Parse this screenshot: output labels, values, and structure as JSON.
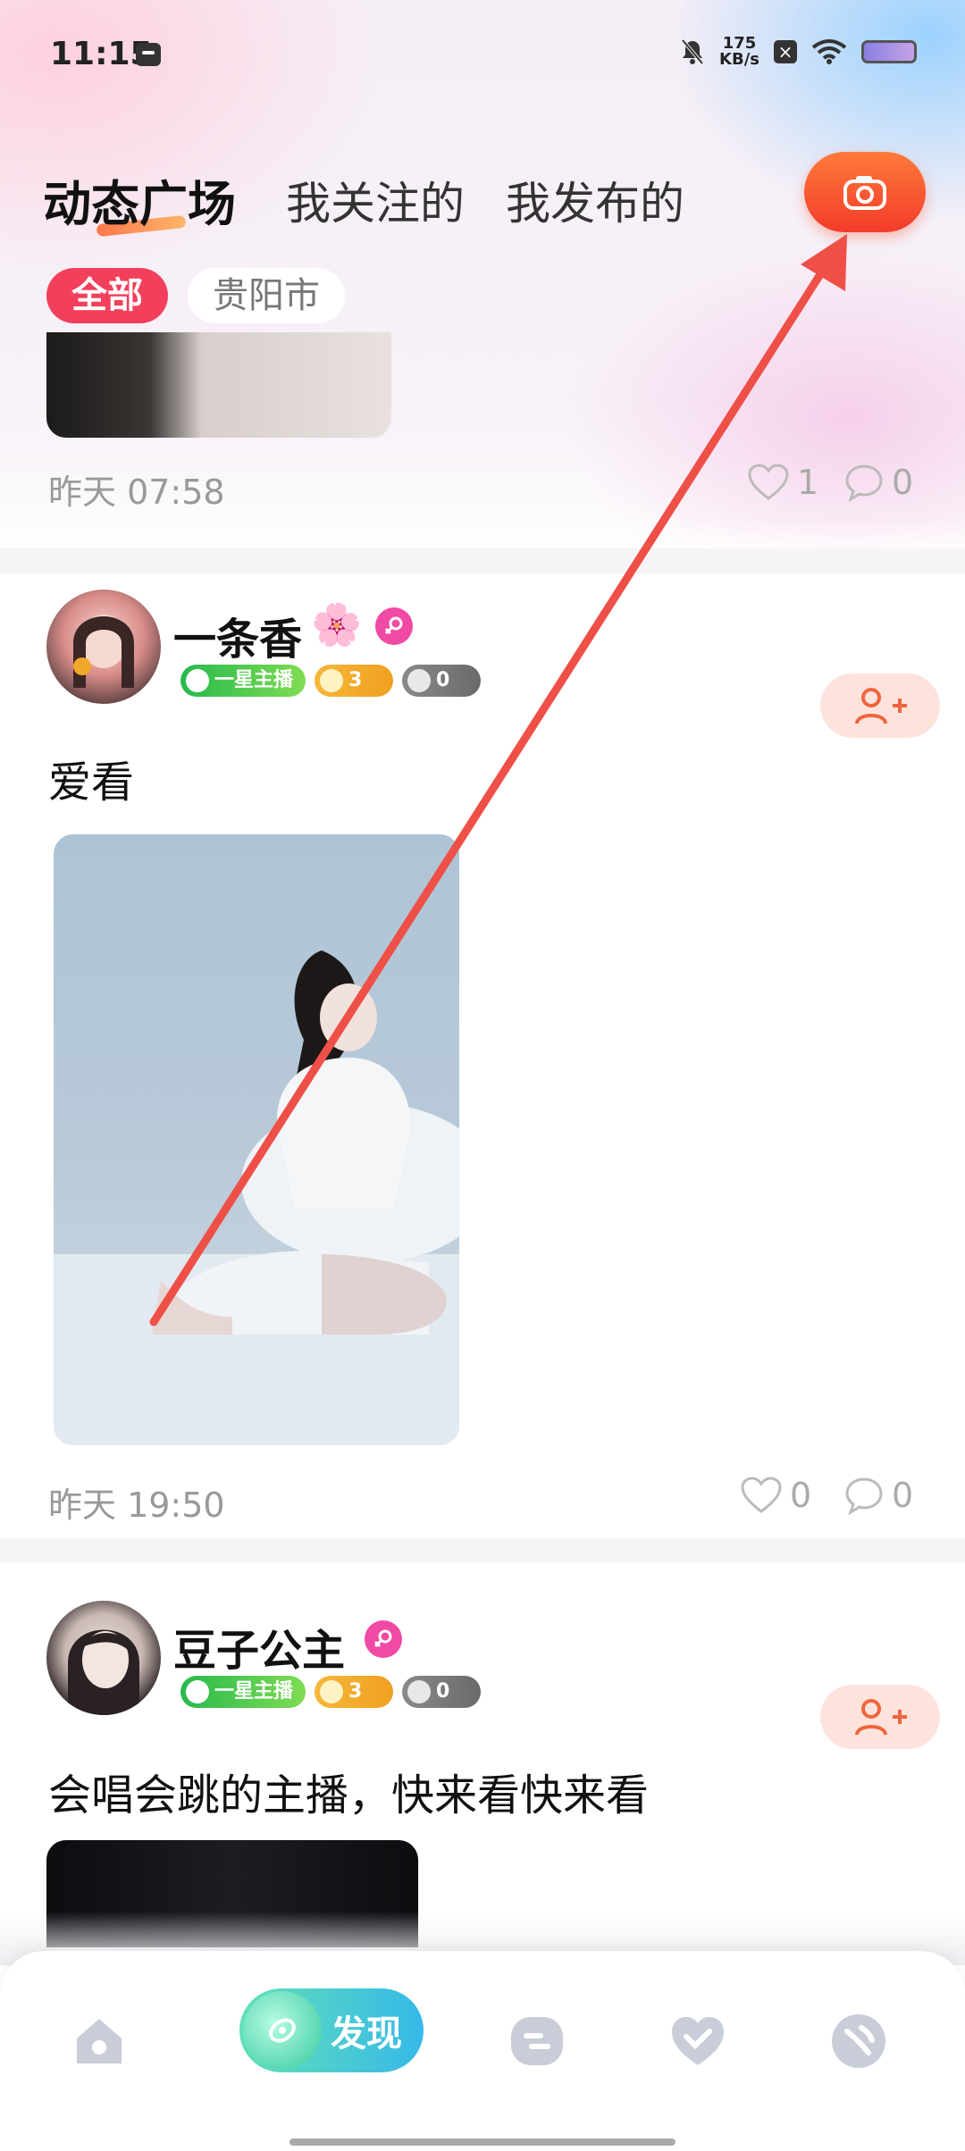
{
  "status_bar": {
    "time": "11:15",
    "net_speed": "175",
    "net_unit": "KB/s"
  },
  "tabs": [
    {
      "label": "动态广场",
      "active": true
    },
    {
      "label": "我关注的",
      "active": false
    },
    {
      "label": "我发布的",
      "active": false
    }
  ],
  "filters": [
    {
      "label": "全部",
      "selected": true
    },
    {
      "label": "贵阳市",
      "selected": false
    }
  ],
  "posts": [
    {
      "time": "昨天 07:58",
      "likes": "1",
      "comments": "0"
    },
    {
      "user": "一条香",
      "emoji": "🌸",
      "gender": "female",
      "level_badge": "一星主播",
      "gold_count": "3",
      "gray_count": "0",
      "text": "爱看",
      "time": "昨天 19:50",
      "likes": "0",
      "comments": "0"
    },
    {
      "user": "豆子公主",
      "gender": "female",
      "level_badge": "一星主播",
      "gold_count": "3",
      "gray_count": "0",
      "text": "会唱会跳的主播，快来看快来看"
    }
  ],
  "bottom_nav": [
    {
      "name": "home",
      "icon": "home-icon"
    },
    {
      "name": "discover",
      "icon": "discover-icon",
      "label": "发现",
      "active": true
    },
    {
      "name": "messages",
      "icon": "message-icon"
    },
    {
      "name": "favorites",
      "icon": "heart-check-icon"
    },
    {
      "name": "profile",
      "icon": "profile-icon"
    }
  ],
  "colors": {
    "accent_red": "#f2405c",
    "camera_orange": "#ff6a35",
    "follow_bg": "#fde3dc",
    "female_pink": "#f04aa4",
    "discover_green": "#3fd0b0",
    "annotation_arrow": "#ee5048"
  }
}
